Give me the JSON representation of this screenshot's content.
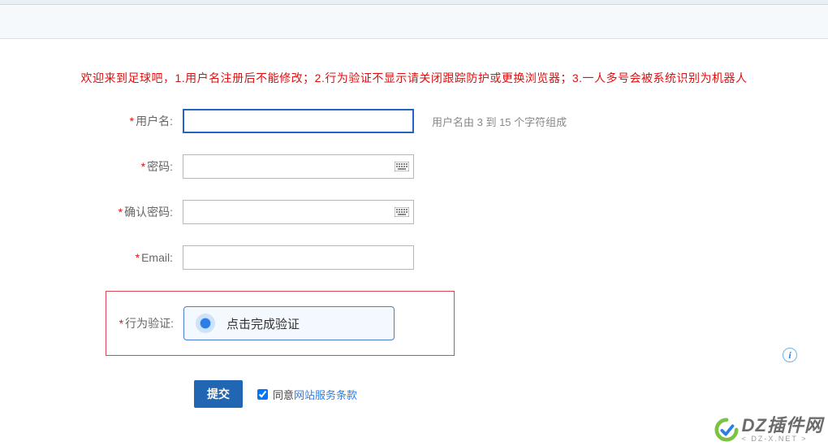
{
  "notice": "欢迎来到足球吧，1.用户名注册后不能修改；2.行为验证不显示请关闭跟踪防护或更换浏览器；3.一人多号会被系统识别为机器人",
  "form": {
    "username": {
      "label": "用户名:",
      "value": "",
      "hint": "用户名由 3 到 15 个字符组成"
    },
    "password": {
      "label": "密码:",
      "value": ""
    },
    "confirm": {
      "label": "确认密码:",
      "value": ""
    },
    "email": {
      "label": "Email:",
      "value": ""
    },
    "verify": {
      "label": "行为验证:",
      "button": "点击完成验证"
    }
  },
  "actions": {
    "submit": "提交",
    "agree_prefix": "同意",
    "tos_link": "网站服务条款"
  },
  "info_icon": "i",
  "watermark": {
    "brand": "DZ插件网",
    "sub": "< DZ-X.NET >"
  }
}
